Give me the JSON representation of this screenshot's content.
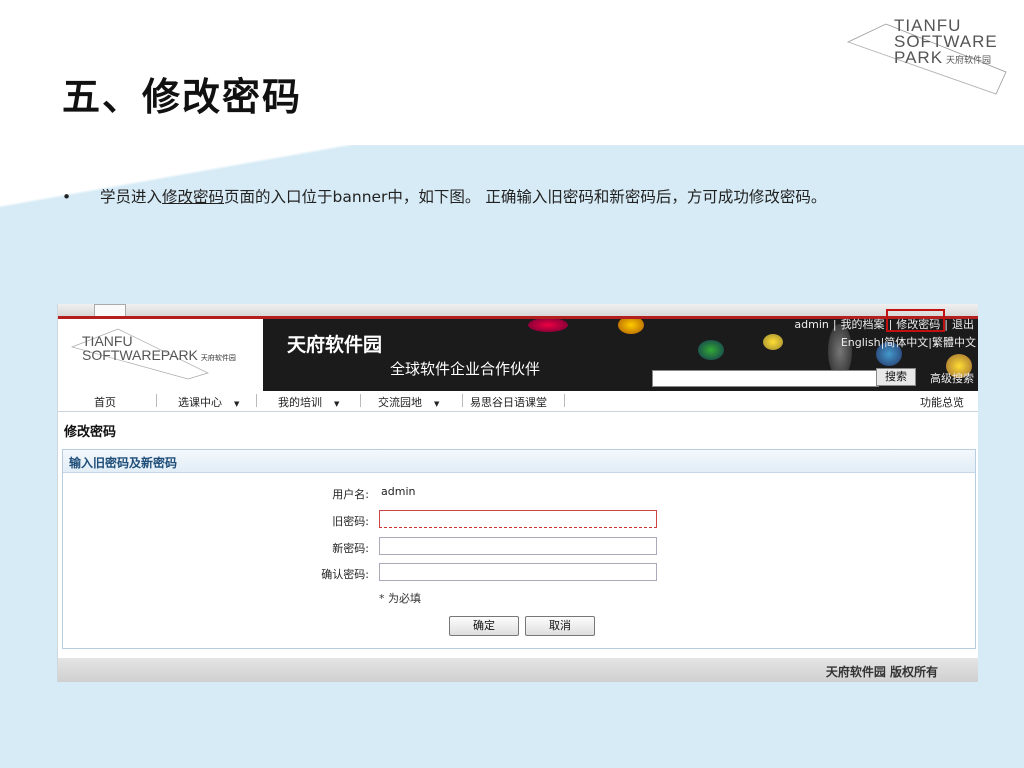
{
  "slide": {
    "title": "五、修改密码",
    "logo": {
      "line1": "TIANFU",
      "line2": "SOFTWARE",
      "line3": "PARK",
      "cn": "天府软件园"
    },
    "bullet": {
      "dot": "•",
      "before": "学员进入",
      "link": "修改密码",
      "after": "页面的入口位于banner中，如下图。 正确输入旧密码和新密码后，方可成功修改密码。"
    }
  },
  "site": {
    "banner": {
      "logo_line1": "TIANFU",
      "logo_line2": "SOFTWAREPARK",
      "logo_cn": "天府软件园",
      "title": "天府软件园",
      "slogan": "全球软件企业合作伙伴"
    },
    "top_links": [
      "admin",
      "我的档案",
      "修改密码",
      "退出"
    ],
    "top_sep": "|",
    "lang_links": [
      "English",
      "简体中文",
      "繁體中文"
    ],
    "search": {
      "button": "搜索",
      "advanced": "高级搜索"
    },
    "nav": {
      "home": "首页",
      "courses": "选课中心",
      "training": "我的培训",
      "community": "交流园地",
      "japanese": "易思谷日语课堂",
      "overview": "功能总览",
      "arrow": "▼"
    },
    "page_heading": "修改密码",
    "form": {
      "panel_title": "输入旧密码及新密码",
      "username_label": "用户名:",
      "username_value": "admin",
      "old_pwd_label": "旧密码:",
      "new_pwd_label": "新密码:",
      "confirm_pwd_label": "确认密码:",
      "required_note": "* 为必填",
      "confirm_button": "确定",
      "cancel_button": "取消"
    },
    "footer": "天府软件园 版权所有"
  },
  "colors": {
    "slide_bg": "#d6ebf6",
    "banner_bg": "#1b1b1b",
    "highlight": "#c01010",
    "panel_title": "#1f4e79"
  }
}
